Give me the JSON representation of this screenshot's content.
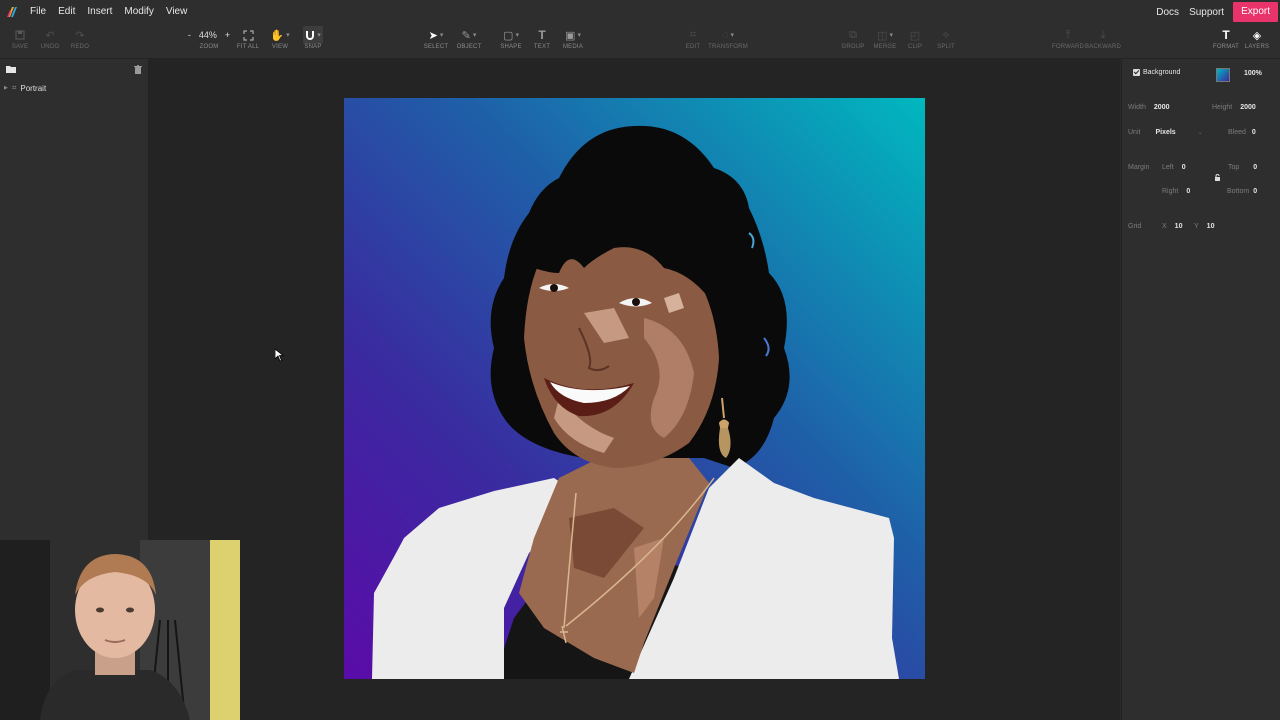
{
  "menubar": {
    "items": [
      "File",
      "Edit",
      "Insert",
      "Modify",
      "View"
    ],
    "docs": "Docs",
    "support": "Support",
    "export": "Export"
  },
  "toolbar": {
    "save": "SAVE",
    "undo": "UNDO",
    "redo": "REDO",
    "zoom_minus": "-",
    "zoom_value": "44%",
    "zoom_plus": "+",
    "zoom": "ZOOM",
    "fit_all": "FIT ALL",
    "view": "VIEW",
    "snap": "SNAP",
    "select": "SELECT",
    "object": "OBJECT",
    "shape": "SHAPE",
    "text": "TEXT",
    "media": "MEDIA",
    "edit": "EDIT",
    "transform": "TRANSFORM",
    "group": "GROUP",
    "merge": "MERGE",
    "clip": "CLIP",
    "split": "SPLIT",
    "forward": "FORWARD",
    "backward": "BACKWARD",
    "format": "FORMAT",
    "layers": "LAYERS"
  },
  "layers": {
    "items": [
      {
        "label": "Portrait"
      }
    ]
  },
  "document": {
    "background_label": "Background",
    "background_opacity": "100%",
    "width_label": "Width",
    "width_value": "2000",
    "height_label": "Height",
    "height_value": "2000",
    "unit_label": "Unit",
    "unit_value": "Pixels",
    "bleed_label": "Bleed",
    "bleed_value": "0",
    "margin_label": "Margin",
    "left_label": "Left",
    "left_value": "0",
    "top_label": "Top",
    "top_value": "0",
    "right_label": "Right",
    "right_value": "0",
    "bottom_label": "Bottom",
    "bottom_value": "0",
    "grid_label": "Grid",
    "grid_x_label": "X",
    "grid_x_value": "10",
    "grid_y_label": "Y",
    "grid_y_value": "10"
  },
  "colors": {
    "accent": "#e8336b",
    "background_gradient_top": "#00b8bf",
    "background_gradient_bottom": "#5a0ba8"
  }
}
